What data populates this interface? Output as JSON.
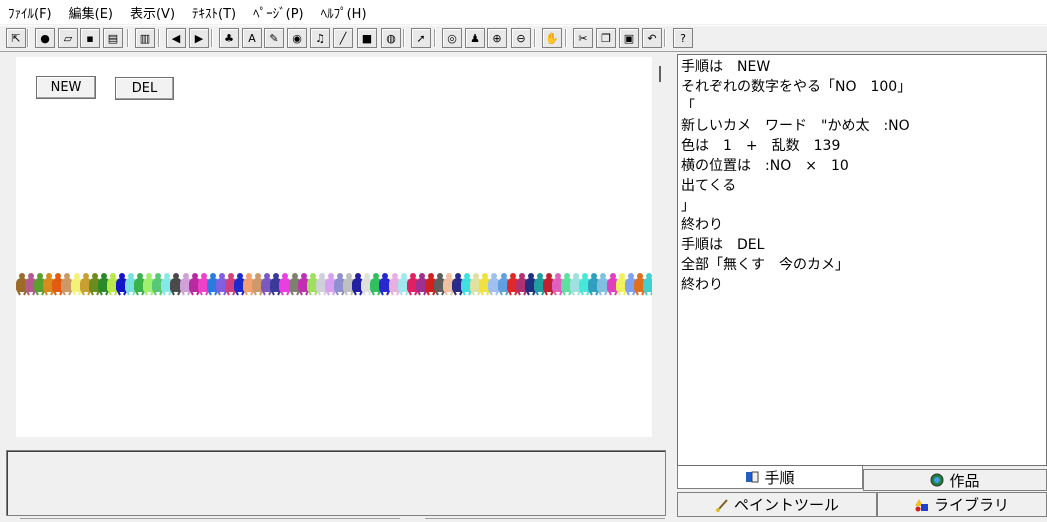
{
  "menu": [
    "ﾌｧｲﾙ(F)",
    "編集(E)",
    "表示(V)",
    "ﾃｷｽﾄ(T)",
    "ﾍﾟｰｼﾞ(P)",
    "ﾍﾙﾌﾟ(H)"
  ],
  "toolbar": {
    "tools": [
      {
        "name": "minimize-tool-icon",
        "glyph": "⇱"
      },
      {
        "name": "globe-icon",
        "glyph": "●"
      },
      {
        "name": "open-folder-icon",
        "glyph": "▱"
      },
      {
        "name": "save-disk-icon",
        "glyph": "▪"
      },
      {
        "name": "print-icon",
        "glyph": "▤"
      },
      {
        "name": "layout-icon",
        "glyph": "▥"
      },
      {
        "name": "arrow-left-icon",
        "glyph": "◀"
      },
      {
        "name": "arrow-right-icon",
        "glyph": "▶"
      },
      {
        "name": "turtle-icon",
        "glyph": "♣"
      },
      {
        "name": "text-a-icon",
        "glyph": "A"
      },
      {
        "name": "paint-brush-icon",
        "glyph": "✎"
      },
      {
        "name": "eraser-icon",
        "glyph": "◉"
      },
      {
        "name": "music-note-icon",
        "glyph": "♫"
      },
      {
        "name": "pen-icon",
        "glyph": "╱"
      },
      {
        "name": "video-camera-icon",
        "glyph": "■"
      },
      {
        "name": "world-map-icon",
        "glyph": "◍"
      },
      {
        "name": "pointer-icon",
        "glyph": "➚"
      },
      {
        "name": "eye-icon",
        "glyph": "◎"
      },
      {
        "name": "stamp-icon",
        "glyph": "♟"
      },
      {
        "name": "zoom-in-icon",
        "glyph": "⊕"
      },
      {
        "name": "zoom-out-icon",
        "glyph": "⊖"
      },
      {
        "name": "stop-hand-icon",
        "glyph": "✋"
      },
      {
        "name": "cut-icon",
        "glyph": "✂"
      },
      {
        "name": "copy-icon",
        "glyph": "❐"
      },
      {
        "name": "paste-icon",
        "glyph": "▣"
      },
      {
        "name": "undo-icon",
        "glyph": "↶"
      },
      {
        "name": "help-icon",
        "glyph": "?"
      }
    ]
  },
  "canvas": {
    "new_button": "NEW",
    "del_button": "DEL"
  },
  "editor": {
    "lines": [
      "手順は　NEW",
      "それぞれの数字をやる「NO　100」",
      "「",
      "新しいカメ　ワード　\"かめ太　:NO",
      "色は　1　+　乱数　139",
      "横の位置は　:NO　×　10",
      "出てくる",
      "」",
      "終わり",
      "手順は　DEL",
      "全部「無くす　今のカメ」",
      "終わり"
    ]
  },
  "tabs": {
    "procedure": "手順",
    "works": "作品",
    "paint_tool": "ペイントツール",
    "library": "ライブラリ"
  },
  "colors": {
    "turtles": [
      "#9b6b2a",
      "#b45a8c",
      "#5aa02f",
      "#d88a1c",
      "#e35a12",
      "#cc9966",
      "#f2f27a",
      "#c8a032",
      "#6b8c1e",
      "#2a8a2a",
      "#b8e84a",
      "#1414c8",
      "#7ae0e0",
      "#3ab44a",
      "#a0f070",
      "#58c878",
      "#88e8e8",
      "#4a4a4a",
      "#d0a0d8",
      "#b82aa0",
      "#f040c8",
      "#2a7ae0",
      "#8060e0",
      "#d04080",
      "#1e2acc",
      "#f4a070",
      "#d09868",
      "#7a5ac0",
      "#3a3a9a",
      "#e840e0",
      "#808070",
      "#c030b0",
      "#a0e060",
      "#d0d0d8",
      "#d8a0f0",
      "#9090d0",
      "#c0c0c0",
      "#2020a0",
      "#e0e0e0",
      "#30c060",
      "#2828d0",
      "#e8b0e0",
      "#a0e8f0",
      "#e02060",
      "#a03090",
      "#d02020",
      "#5e5e5e",
      "#f0c0a0",
      "#2a2a8a",
      "#40e0e0",
      "#e0e0a0",
      "#f0e040",
      "#a0c0f0",
      "#60a0e0",
      "#e02828",
      "#b03070",
      "#203080",
      "#1ea0a0",
      "#c02030",
      "#e060c0",
      "#60e0a0",
      "#a0e0e0",
      "#48e8d8",
      "#30a0c0",
      "#80c0e0",
      "#e040c0",
      "#f0f060",
      "#80a0f0",
      "#e07020",
      "#40d0d0"
    ]
  }
}
